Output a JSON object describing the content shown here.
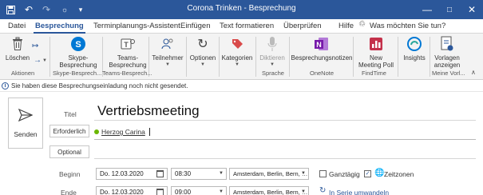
{
  "window": {
    "title": "Corona Trinken  -  Besprechung",
    "quick_access": [
      "save-icon",
      "undo-icon",
      "redo-icon",
      "touch-mode-icon",
      "customize-icon"
    ]
  },
  "tabs": [
    {
      "label": "Datei",
      "active": false
    },
    {
      "label": "Besprechung",
      "active": true
    },
    {
      "label": "Terminplanungs-Assistent",
      "active": false
    },
    {
      "label": "Einfügen",
      "active": false
    },
    {
      "label": "Text formatieren",
      "active": false
    },
    {
      "label": "Überprüfen",
      "active": false
    },
    {
      "label": "Hilfe",
      "active": false
    }
  ],
  "tell_me": "Was möchten Sie tun?",
  "ribbon": {
    "delete": "Löschen",
    "skype": {
      "line1": "Skype-",
      "line2": "Besprechung"
    },
    "teams": {
      "line1": "Teams-",
      "line2": "Besprechung"
    },
    "participants": "Teilnehmer",
    "options": "Optionen",
    "categories": "Kategorien",
    "dictate": "Diktieren",
    "notes": "Besprechungsnotizen",
    "poll": {
      "line1": "New",
      "line2": "Meeting Poll"
    },
    "insights": "Insights",
    "templates": {
      "line1": "Vorlagen",
      "line2": "anzeigen"
    },
    "groups": {
      "actions": "Aktionen",
      "skype": "Skype-Besprech...",
      "teams": "Teams-Besprech...",
      "speech": "Sprache",
      "onenote": "OneNote",
      "findtime": "FindTime",
      "my": "Meine Vorl..."
    }
  },
  "info_text": "Sie haben diese Besprechungseinladung noch nicht gesendet.",
  "form": {
    "send": "Senden",
    "title_label": "Titel",
    "title_value": "Vertriebsmeeting",
    "required_button": "Erforderlich",
    "optional_button": "Optional",
    "attendee": "Herzog Carina",
    "start_label": "Beginn",
    "end_label": "Ende",
    "start_date": "Do. 12.03.2020",
    "end_date": "Do. 12.03.2020",
    "start_time": "08:30",
    "end_time": "09:00",
    "timezone_start": "Amsterdam, Berlin, Bern, …",
    "timezone_end": "Amsterdam, Berlin, Bern, …",
    "all_day": "Ganztägig",
    "all_day_checked": false,
    "timezones": "Zeitzonen",
    "timezones_checked": true,
    "recurring": "In Serie umwandeln"
  },
  "colors": {
    "accent": "#2b579a",
    "presence": "#6bb700",
    "skype": "#0078d4",
    "onenote": "#7719aa",
    "poll": "#c4314b"
  }
}
